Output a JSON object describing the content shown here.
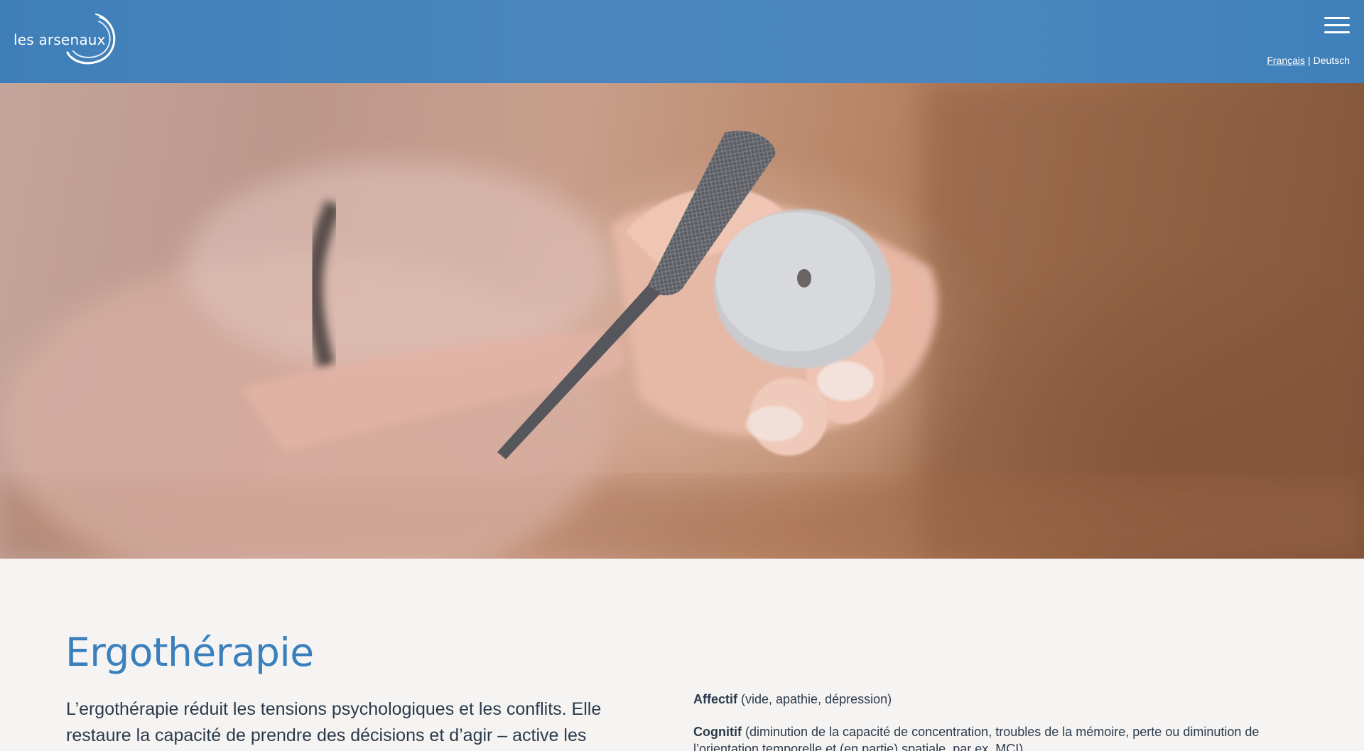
{
  "header": {
    "logo_text": "les arsenaux",
    "menu_icon": "hamburger-menu-icon",
    "languages": [
      {
        "label": "Français",
        "active": true
      },
      {
        "label": "Deutsch",
        "active": false
      }
    ],
    "language_separator": "|",
    "colors": {
      "header_bg": "#4a86bd",
      "text": "#ffffff"
    }
  },
  "hero": {
    "image_description": "Close-up of hands filing a round soapstone disc with a small rasp"
  },
  "main": {
    "title": "Ergothérapie",
    "intro": "L’ergothérapie réduit les tensions psychologiques et les conflits. Elle restaure la capacité de prendre des décisions et d’agir – active les ressources. De cette",
    "items": [
      {
        "term": "Affectif",
        "text": " (vide, apathie, dépression)"
      },
      {
        "term": "Cognitif",
        "text": " (diminution de la capacité de concentration, troubles de la mémoire, perte ou diminution de l’orientation temporelle et (en partie) spatiale, par ex. MCI)"
      }
    ],
    "colors": {
      "title": "#3a80bd",
      "text": "#2b3a4a",
      "background": "#f6f4f3"
    }
  }
}
